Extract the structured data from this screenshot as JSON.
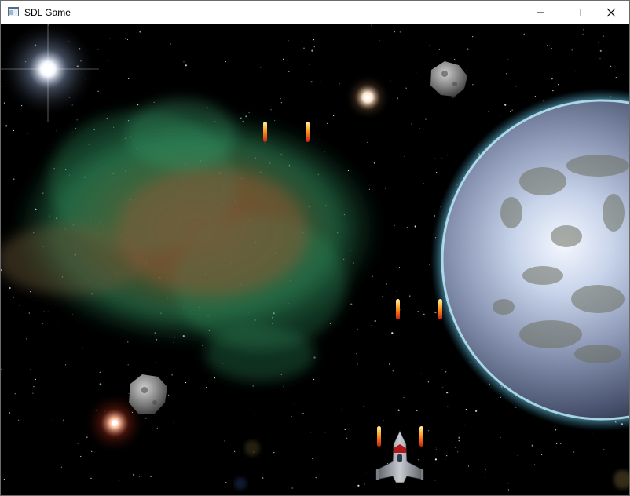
{
  "window": {
    "title": "SDL Game",
    "controls": [
      "minimize-icon",
      "maximize-icon",
      "close-icon"
    ]
  },
  "scene": {
    "background_color": "#000000",
    "objects": [
      {
        "kind": "star",
        "color": "#ffffff"
      },
      {
        "kind": "star",
        "color": "#ffffff"
      },
      {
        "kind": "star",
        "color": "#ff5a3a"
      },
      {
        "kind": "nebula",
        "colors": [
          "#2e8a5a",
          "#8a5a3a"
        ]
      },
      {
        "kind": "planet",
        "colors": [
          "#8fd8ff",
          "#a0a8b8",
          "#6d7060"
        ]
      },
      {
        "kind": "asteroid",
        "color": "#8a8a8a"
      },
      {
        "kind": "asteroid",
        "color": "#8a8a8a"
      },
      {
        "kind": "player-ship",
        "color": "#9aa0a6"
      }
    ],
    "bullet_colors": [
      "#fff6a0",
      "#ff9a20",
      "#d02010"
    ],
    "bullet_count": 6
  }
}
